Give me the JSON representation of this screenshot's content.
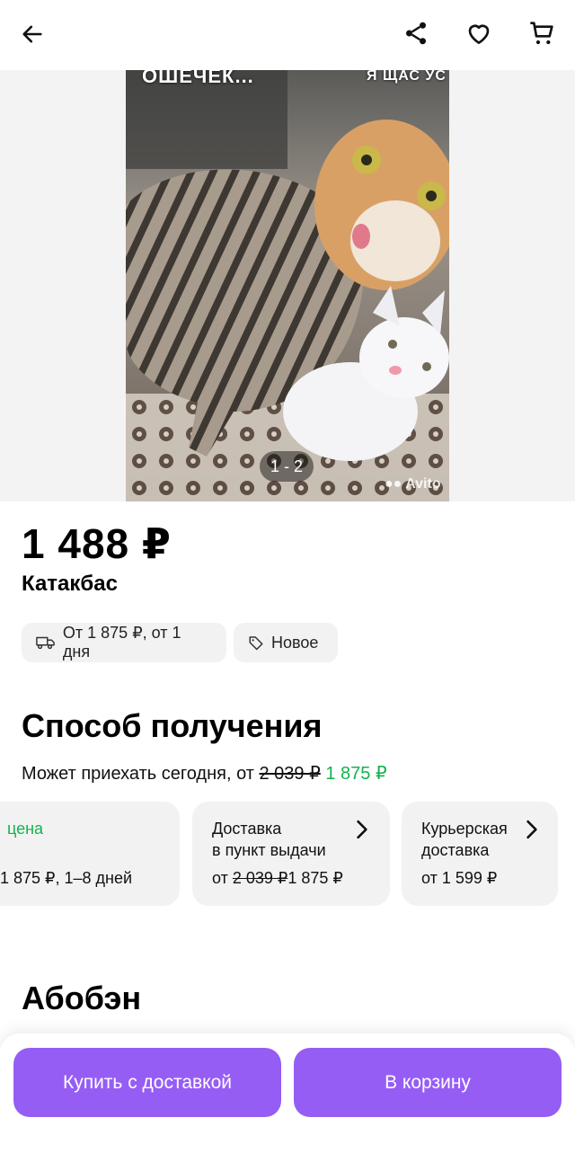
{
  "header": {
    "back_icon": "arrow-left-icon",
    "share_icon": "share-icon",
    "favorite_icon": "heart-icon",
    "cart_icon": "cart-icon"
  },
  "gallery": {
    "counter": "1 - 2",
    "watermark": "Avito",
    "overlay_left": "ОШЕЧЕК...",
    "overlay_right": "Я ЩАС УС"
  },
  "product": {
    "price": "1 488 ₽",
    "title": "Катакбас"
  },
  "chips": {
    "delivery": "От 1 875 ₽, от 1 дня",
    "condition": "Новое"
  },
  "receive": {
    "heading": "Способ получения",
    "subtitle_prefix": "Может приехать сегодня, от",
    "subtitle_old_price": "2 039 ₽",
    "subtitle_new_price": "1 875 ₽"
  },
  "cards": [
    {
      "title": "цена",
      "bottom": "1 875 ₽, 1–8 дней"
    },
    {
      "title_line1": "Доставка",
      "title_line2": "в пункт выдачи",
      "prefix": "от",
      "old_price": "2 039 ₽",
      "new_price": "1 875 ₽"
    },
    {
      "title_line1": "Курьерская",
      "title_line2": "доставка",
      "bottom": "от 1 599 ₽"
    }
  ],
  "section2": {
    "heading": "Абобэн"
  },
  "actions": {
    "buy_label": "Купить с доставкой",
    "cart_label": "В корзину"
  },
  "colors": {
    "accent": "#965df5",
    "price_green": "#12b34d",
    "chip_bg": "#f2f2f2"
  }
}
